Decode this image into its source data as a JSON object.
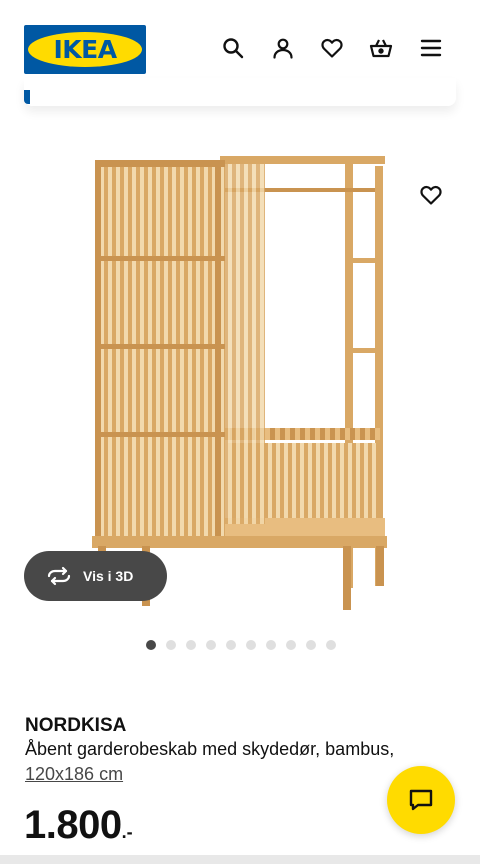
{
  "header": {
    "logo_text": "IKEA",
    "icons": [
      "search-icon",
      "user-icon",
      "heart-icon",
      "basket-icon",
      "menu-icon"
    ]
  },
  "colors": {
    "ikea_blue": "#0058a3",
    "ikea_yellow": "#ffdb00",
    "view3d_bg": "#484848",
    "bamboo": "#d9a865"
  },
  "media": {
    "favorite_icon": "heart-icon",
    "view3d_label": "Vis i 3D",
    "image_count": 10,
    "active_image": 1
  },
  "product": {
    "name": "NORDKISA",
    "description": "Åbent garderobeskab med skydedør, bambus,",
    "size": "120x186 cm",
    "price_integer": "1.800",
    "price_suffix": ".-"
  },
  "chat": {
    "icon": "chat-icon"
  }
}
